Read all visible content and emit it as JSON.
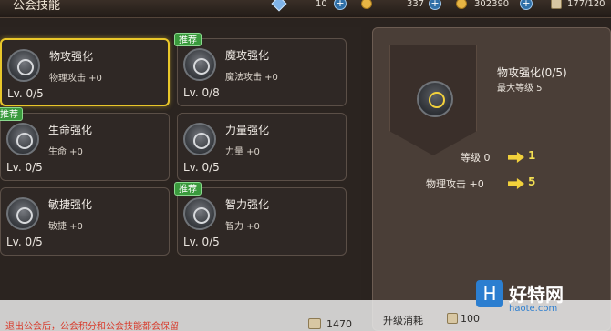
{
  "header": {
    "title": "公会技能",
    "resources": [
      {
        "icon": "blue-gem-icon",
        "value": "10"
      },
      {
        "icon": "gold-icon",
        "value": "337"
      },
      {
        "icon": "coin-icon",
        "value": "302390"
      },
      {
        "icon": "scroll-icon",
        "value": "177/120"
      }
    ]
  },
  "skills": [
    {
      "name": "物攻强化",
      "desc": "物理攻击 +0",
      "level": "Lv. 0/5",
      "recommended": false,
      "selected": true,
      "icon": "physical-attack-icon"
    },
    {
      "name": "魔攻强化",
      "desc": "魔法攻击 +0",
      "level": "Lv. 0/8",
      "recommended": true,
      "selected": false,
      "icon": "magic-attack-icon"
    },
    {
      "name": "生命强化",
      "desc": "生命 +0",
      "level": "Lv. 0/5",
      "recommended": true,
      "selected": false,
      "icon": "hp-icon"
    },
    {
      "name": "力量强化",
      "desc": "力量 +0",
      "level": "Lv. 0/5",
      "recommended": false,
      "selected": false,
      "icon": "strength-icon"
    },
    {
      "name": "敏捷强化",
      "desc": "敏捷 +0",
      "level": "Lv. 0/5",
      "recommended": false,
      "selected": false,
      "icon": "agility-icon"
    },
    {
      "name": "智力强化",
      "desc": "智力 +0",
      "level": "Lv. 0/5",
      "recommended": true,
      "selected": false,
      "icon": "intelligence-icon"
    }
  ],
  "badge_label": "推荐",
  "detail": {
    "title": "物攻强化(0/5)",
    "max_level": "最大等级 5",
    "stats": [
      {
        "label": "等级 0",
        "to": "1"
      },
      {
        "label": "物理攻击 +0",
        "to": "5"
      }
    ]
  },
  "footer": {
    "note": "退出公会后，公会积分和公会技能都会保留",
    "points": "1470",
    "upgrade_label": "升级消耗",
    "upgrade_cost": "100"
  },
  "watermark": {
    "letter": "H",
    "text": "好特网",
    "url": "haote.com"
  },
  "colors": {
    "selected_border": "#e9c72a",
    "badge_green": "#3a9a3d",
    "value_yellow": "#f3df52"
  }
}
